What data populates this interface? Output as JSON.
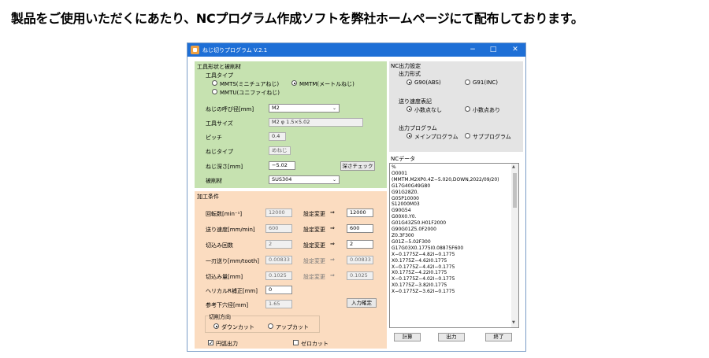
{
  "headline": "製品をご使用いただくにあたり、NCプログラム作成ソフトを弊社ホームページにて配布しております。",
  "window": {
    "title": "ねじ切りプログラム V.2.1",
    "minimize": "−",
    "maximize": "□",
    "close": "✕"
  },
  "shape": {
    "title": "工具形状と被削材",
    "tool_type_label": "工具タイプ",
    "tool_types": [
      "MMTS(ミニチュアねじ)",
      "MMTM(メートルねじ)",
      "MMTU(ユニファイねじ)"
    ],
    "selected_tool_type": "MMTM(メートルねじ)",
    "nominal_diameter_label": "ねじの呼び径[mm]",
    "nominal_diameter_value": "M2",
    "tool_size_label": "工具サイズ",
    "tool_size_value": "M2 φ 1.5×5.02",
    "pitch_label": "ピッチ",
    "pitch_value": "0.4",
    "thread_type_label": "ねじタイプ",
    "thread_type_value": "めねじ",
    "thread_depth_label": "ねじ深さ[mm]",
    "thread_depth_value": "−5.02",
    "depth_check_button": "深さチェック",
    "material_label": "被削材",
    "material_value": "SUS304"
  },
  "cutting": {
    "title": "加工条件",
    "setting_change": "設定変更",
    "arrow": "⇒",
    "rows": [
      {
        "label": "回転数[min⁻¹]",
        "default": "12000",
        "value": "12000",
        "editable": true
      },
      {
        "label": "送り速度[mm/min]",
        "default": "600",
        "value": "600",
        "editable": true
      },
      {
        "label": "切込み回数",
        "default": "2",
        "value": "2",
        "editable": true
      },
      {
        "label": "一刃送り[mm/tooth]",
        "default": "0.00833",
        "value": "0.00833",
        "editable": false
      },
      {
        "label": "切込み量[mm]",
        "default": "0.1025",
        "value": "0.1025",
        "editable": false
      }
    ],
    "helical_label": "ヘリカルR補正[mm]",
    "helical_value": "0",
    "ref_hole_label": "参考下穴径[mm]",
    "ref_hole_value": "1.65",
    "confirm_button": "入力確定",
    "direction_label": "切削方向",
    "directions": [
      "ダウンカット",
      "アップカット"
    ],
    "selected_direction": "ダウンカット",
    "arc_output_label": "円弧出力",
    "arc_output_checked": true,
    "zero_cut_label": "ゼロカット",
    "zero_cut_checked": false
  },
  "nc_settings": {
    "title": "NC出力設定",
    "format_label": "出力形式",
    "formats": [
      "G90(ABS)",
      "G91(INC)"
    ],
    "selected_format": "G90(ABS)",
    "feed_label": "送り速度表記",
    "feeds": [
      "小数点なし",
      "小数点あり"
    ],
    "selected_feed": "小数点なし",
    "program_label": "出力プログラム",
    "programs": [
      "メインプログラム",
      "サブプログラム"
    ],
    "selected_program": "メインプログラム"
  },
  "nc_data": {
    "title": "NCデータ",
    "lines": [
      "%",
      "O0001",
      "(MMTM.M2XP0.4Z−5.020,DOWN,2022/09/20)",
      "G17G40G49G80",
      "G91G28Z0.",
      "G05P10000",
      "S12000M03",
      "G90G54",
      "G00X0.Y0.",
      "G01G43Z50.H01F2000",
      "G90G01Z5.0F2000",
      "Z0.3F300",
      "G01Z−5.02F300",
      "G17G03X0.1775I0.08875F600",
      "X−0.1775Z−4.82I−0.1775",
      "X0.1775Z−4.62I0.1775",
      "X−0.1775Z−4.42I−0.1775",
      "X0.1775Z−4.22I0.1775",
      "X−0.1775Z−4.02I−0.1775",
      "X0.1775Z−3.82I0.1775",
      "X−0.1775Z−3.62I−0.1775"
    ]
  },
  "buttons": {
    "calculate": "計算",
    "output": "出力",
    "exit": "終了"
  },
  "colors": {
    "titlebar": "#1e6fd6",
    "shape_panel": "#c6e2b0",
    "cutting_panel": "#fbdcc0",
    "settings_panel": "#e4e4e4"
  }
}
